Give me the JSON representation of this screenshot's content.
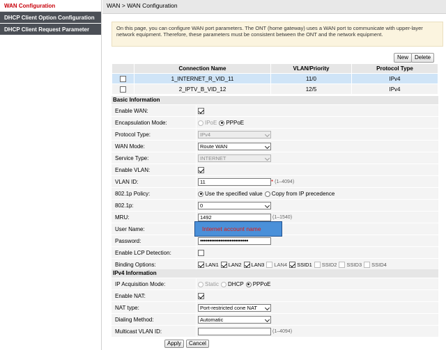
{
  "sidebar": {
    "items": [
      {
        "label": "WAN Configuration"
      },
      {
        "label": "DHCP Client Option Configuration"
      },
      {
        "label": "DHCP Client Request Parameter"
      }
    ]
  },
  "breadcrumb": "WAN > WAN Configuration",
  "intro_text": "On this page, you can configure WAN port parameters. The ONT (home gateway) uses a WAN port to communicate with upper-layer network equipment. Therefore, these parameters must be consistent between the ONT and the network equipment.",
  "toolbar": {
    "new_label": "New",
    "delete_label": "Delete"
  },
  "connections": {
    "headers": [
      "",
      "Connection Name",
      "VLAN/Priority",
      "Protocol Type"
    ],
    "rows": [
      {
        "name": "1_INTERNET_R_VID_11",
        "vlan": "11/0",
        "protocol": "IPv4",
        "selected": true
      },
      {
        "name": "2_IPTV_B_VID_12",
        "vlan": "12/5",
        "protocol": "IPv4",
        "selected": false
      }
    ]
  },
  "basic": {
    "title": "Basic Information",
    "enable_wan": "Enable WAN:",
    "encap_label": "Encapsulation Mode:",
    "encap_opt1": "IPoE",
    "encap_opt2": "PPPoE",
    "protocol_label": "Protocol Type:",
    "protocol_value": "IPv4",
    "wan_mode_label": "WAN Mode:",
    "wan_mode_value": "Route WAN",
    "service_label": "Service Type:",
    "service_value": "INTERNET",
    "enable_vlan": "Enable VLAN:",
    "vlan_id_label": "VLAN ID:",
    "vlan_id_value": "11",
    "vlan_id_req": "*",
    "vlan_id_hint": "(1–4094)",
    "policy_label": "802.1p Policy:",
    "policy_opt1": "Use the specified value",
    "policy_opt2": "Copy from IP precedence",
    "p8021_label": "802.1p:",
    "p8021_value": "0",
    "mru_label": "MRU:",
    "mru_value": "1492",
    "mru_hint": "(1–1540)",
    "user_label": "User Name:",
    "user_tooltip": "Internet account name",
    "password_label": "Password:",
    "password_value": "••••••••••••••••••••••••••",
    "lcp_label": "Enable LCP Detection:",
    "binding_label": "Binding Options:",
    "binding": [
      {
        "label": "LAN1",
        "checked": true
      },
      {
        "label": "LAN2",
        "checked": true
      },
      {
        "label": "LAN3",
        "checked": true
      },
      {
        "label": "LAN4",
        "checked": false
      },
      {
        "label": "SSID1",
        "checked": true
      },
      {
        "label": "SSID2",
        "checked": false
      },
      {
        "label": "SSID3",
        "checked": false
      },
      {
        "label": "SSID4",
        "checked": false
      }
    ]
  },
  "ipv4": {
    "title": "IPv4 Information",
    "acq_label": "IP Acquisition Mode:",
    "acq_opt1": "Static",
    "acq_opt2": "DHCP",
    "acq_opt3": "PPPoE",
    "nat_label": "Enable NAT:",
    "nat_type_label": "NAT type:",
    "nat_type_value": "Port-restricted cone NAT",
    "dial_label": "Dialing Method:",
    "dial_value": "Automatic",
    "mcast_label": "Multicast VLAN ID:",
    "mcast_hint": "(1–4094)"
  },
  "footer": {
    "apply_label": "Apply",
    "cancel_label": "Cancel"
  },
  "colors": {
    "accent": "#c8000a",
    "sidebar_dark": "#4b4f56",
    "selected_row": "#cfe4f7",
    "tooltip_bg": "#4a90d9"
  }
}
